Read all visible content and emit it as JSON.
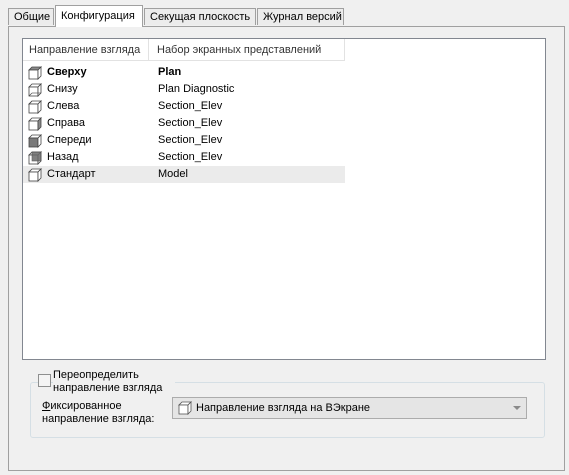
{
  "tabs": [
    {
      "label": "Общие"
    },
    {
      "label": "Конфигурация",
      "active": true
    },
    {
      "label": "Секущая плоскость"
    },
    {
      "label": "Журнал версий"
    }
  ],
  "list": {
    "columns": [
      "Направление взгляда",
      "Набор экранных представлений"
    ],
    "rows": [
      {
        "direction": "Сверху",
        "set": "Plan",
        "icon": "cube-top-icon",
        "bold": true
      },
      {
        "direction": "Снизу",
        "set": "Plan Diagnostic",
        "icon": "cube-bottom-icon"
      },
      {
        "direction": "Слева",
        "set": "Section_Elev",
        "icon": "cube-left-icon"
      },
      {
        "direction": "Справа",
        "set": "Section_Elev",
        "icon": "cube-right-icon"
      },
      {
        "direction": "Спереди",
        "set": "Section_Elev",
        "icon": "cube-front-icon"
      },
      {
        "direction": "Назад",
        "set": "Section_Elev",
        "icon": "cube-back-icon"
      },
      {
        "direction": "Стандарт",
        "set": "Model",
        "icon": "cube-iso-icon",
        "selected": true
      }
    ]
  },
  "override": {
    "label_line1": "Переопределить",
    "label_line2": "направление взгляда",
    "checked": false
  },
  "fixed": {
    "label_first_char": "Ф",
    "label_rest": "иксированное",
    "label_line2": "направление взгляда:",
    "value": "Направление взгляда на ВЭкране"
  }
}
